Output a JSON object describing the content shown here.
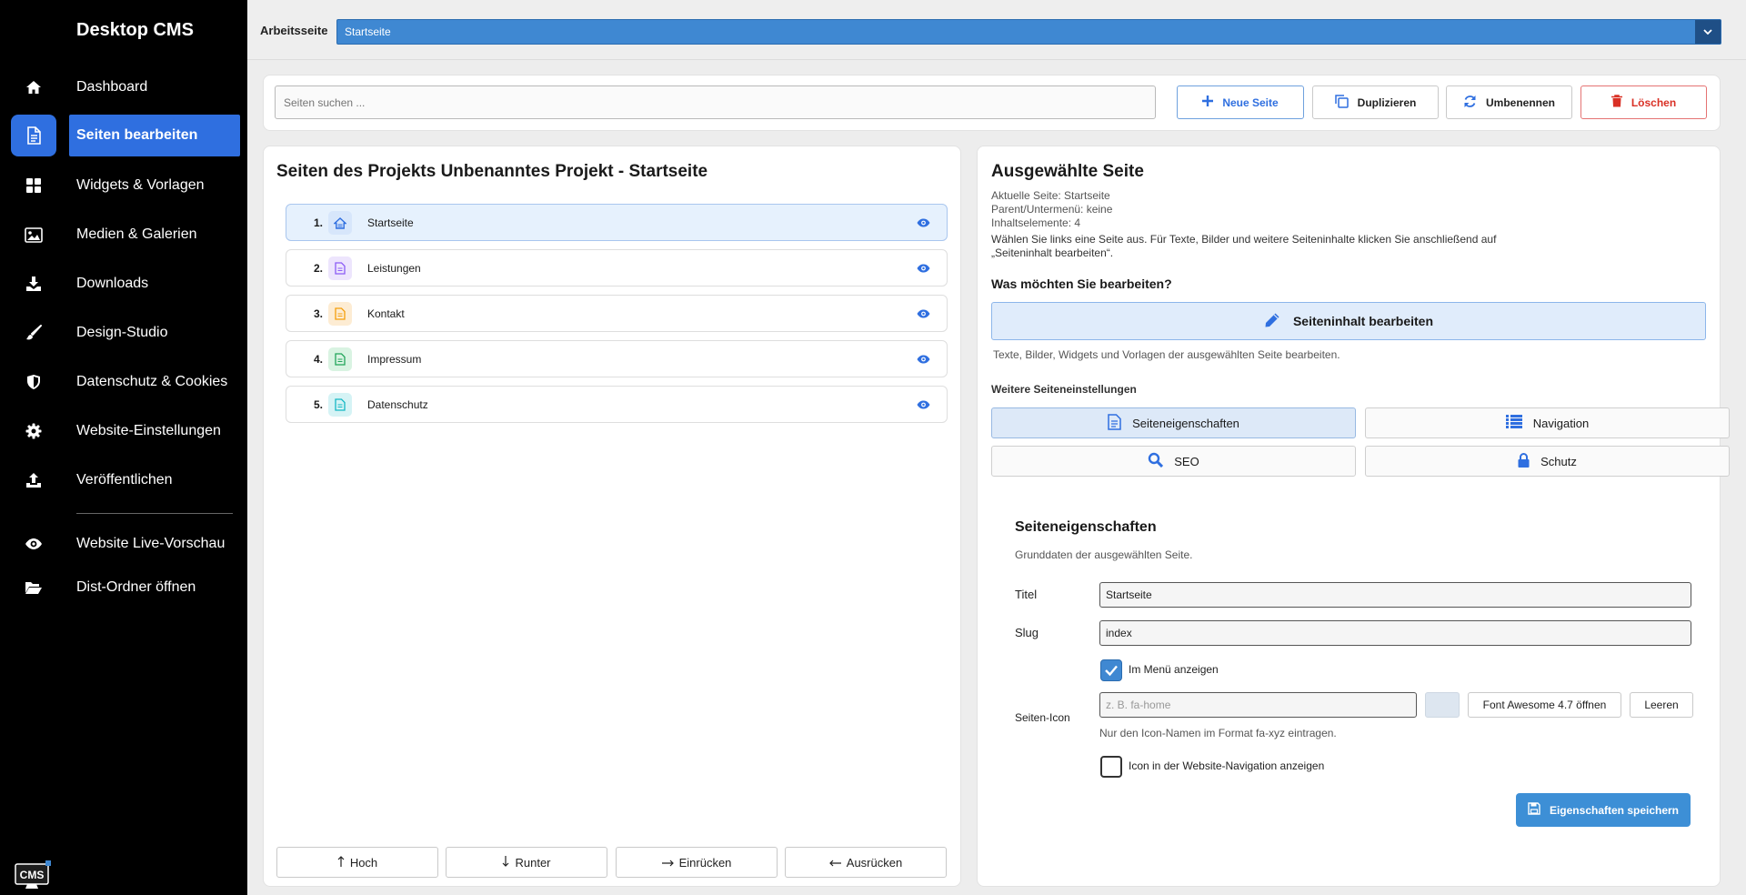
{
  "app": {
    "brand": "Desktop CMS",
    "logo_text": "CMS"
  },
  "sidebar": {
    "items": [
      {
        "label": "Dashboard",
        "icon": "home-icon"
      },
      {
        "label": "Seiten bearbeiten",
        "icon": "file-icon",
        "active": true
      },
      {
        "label": "Widgets & Vorlagen",
        "icon": "grid-icon"
      },
      {
        "label": "Medien & Galerien",
        "icon": "image-icon"
      },
      {
        "label": "Downloads",
        "icon": "download-icon"
      },
      {
        "label": "Design-Studio",
        "icon": "brush-icon"
      },
      {
        "label": "Datenschutz & Cookies",
        "icon": "shield-icon"
      },
      {
        "label": "Website-Einstellungen",
        "icon": "gear-icon"
      },
      {
        "label": "Veröffentlichen",
        "icon": "upload-icon"
      }
    ],
    "secondary": [
      {
        "label": "Website Live-Vorschau",
        "icon": "eye-icon"
      },
      {
        "label": "Dist-Ordner öffnen",
        "icon": "folder-open-icon"
      }
    ]
  },
  "topbar": {
    "label": "Arbeitsseite",
    "selected": "Startseite"
  },
  "toolbar": {
    "search_placeholder": "Seiten suchen ...",
    "new_page": "Neue Seite",
    "duplicate": "Duplizieren",
    "rename": "Umbenennen",
    "delete": "Löschen"
  },
  "pages_panel": {
    "title": "Seiten des Projekts Unbenanntes Projekt - Startseite",
    "pages": [
      {
        "num": "1.",
        "title": "Startseite",
        "color": "#2f6fe0",
        "bg": "#d7e6fb",
        "icon": "home-icon"
      },
      {
        "num": "2.",
        "title": "Leistungen",
        "color": "#8b5cf6",
        "bg": "#ede5fd",
        "icon": "file-icon"
      },
      {
        "num": "3.",
        "title": "Kontakt",
        "color": "#f59e0b",
        "bg": "#fdecd3",
        "icon": "file-icon"
      },
      {
        "num": "4.",
        "title": "Impressum",
        "color": "#22a55a",
        "bg": "#d9f3e2",
        "icon": "file-icon"
      },
      {
        "num": "5.",
        "title": "Datenschutz",
        "color": "#14b8c4",
        "bg": "#d5f3f5",
        "icon": "file-icon"
      }
    ],
    "buttons": {
      "up": "Hoch",
      "down": "Runter",
      "indent": "Einrücken",
      "outdent": "Ausrücken"
    }
  },
  "selected_panel": {
    "title": "Ausgewählte Seite",
    "current": "Aktuelle Seite: Startseite",
    "parent": "Parent/Untermenü: keine",
    "elements": "Inhaltselemente: 4",
    "hint1": "Wählen Sie links eine Seite aus. Für Texte, Bilder und weitere Seiteninhalte klicken Sie anschließend auf",
    "hint2": "„Seiteninhalt bearbeiten“.",
    "question": "Was möchten Sie bearbeiten?",
    "edit_content": "Seiteninhalt bearbeiten",
    "edit_content_desc": "Texte, Bilder, Widgets und Vorlagen der ausgewählten Seite bearbeiten.",
    "more_settings": "Weitere Seiteneinstellungen",
    "tabs": {
      "properties": "Seiteneigenschaften",
      "navigation": "Navigation",
      "seo": "SEO",
      "protection": "Schutz"
    }
  },
  "properties": {
    "title": "Seiteneigenschaften",
    "subtitle": "Grunddaten der ausgewählten Seite.",
    "title_label": "Titel",
    "title_value": "Startseite",
    "slug_label": "Slug",
    "slug_value": "index",
    "show_in_menu": "Im Menü anzeigen",
    "show_in_menu_checked": true,
    "icon_label": "Seiten-Icon",
    "icon_placeholder": "z. B. fa-home",
    "fa_button": "Font Awesome 4.7 öffnen",
    "clear_button": "Leeren",
    "icon_hint": "Nur den Icon-Namen im Format fa-xyz eintragen.",
    "show_icon_nav": "Icon in der Website-Navigation anzeigen",
    "show_icon_nav_checked": false,
    "save_button": "Eigenschaften speichern"
  },
  "colors": {
    "accent": "#2f6fe0",
    "primary_button": "#3d8fd6",
    "danger": "#d93025"
  }
}
